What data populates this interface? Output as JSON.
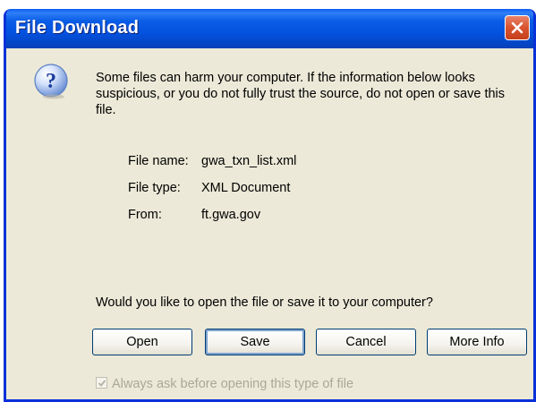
{
  "window": {
    "title": "File Download"
  },
  "message": "Some files can harm your computer. If the information below looks suspicious, or you do not fully trust the source, do not open or save this file.",
  "file_info": {
    "name_label": "File name:",
    "name_value": "gwa_txn_list.xml",
    "type_label": "File type:",
    "type_value": "XML Document",
    "from_label": "From:",
    "from_value": "ft.gwa.gov"
  },
  "prompt": "Would you like to open the file or save it to your computer?",
  "buttons": {
    "open": "Open",
    "save": "Save",
    "cancel": "Cancel",
    "more_info": "More Info"
  },
  "checkbox": {
    "label": "Always ask before opening this type of file",
    "checked": true,
    "disabled": true
  },
  "colors": {
    "titlebar": "#0452e0",
    "dialog_bg": "#ece9d8",
    "close_btn": "#d9532e"
  },
  "icons": {
    "dialog": "question-icon",
    "close": "close-icon"
  }
}
